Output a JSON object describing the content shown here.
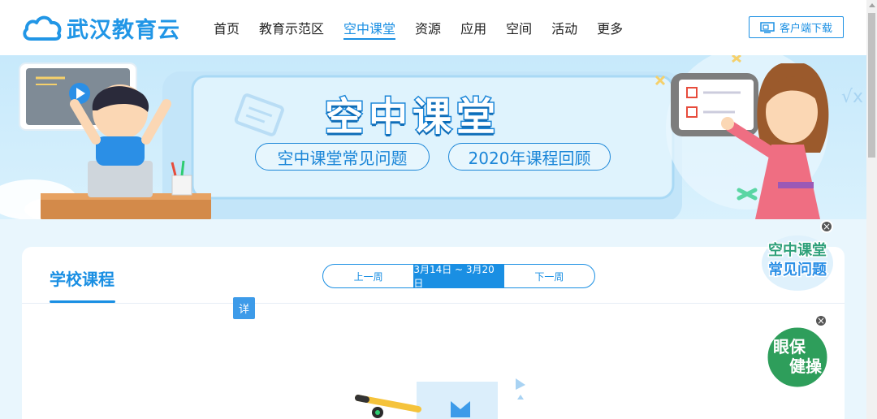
{
  "header": {
    "logo_text": "武汉教育云",
    "nav": [
      {
        "label": "首页"
      },
      {
        "label": "教育示范区"
      },
      {
        "label": "空中课堂",
        "active": true
      },
      {
        "label": "资源"
      },
      {
        "label": "应用"
      },
      {
        "label": "空间"
      },
      {
        "label": "活动"
      },
      {
        "label": "更多"
      }
    ],
    "download_label": "客户端下载"
  },
  "banner": {
    "title": "空中课堂",
    "pills": [
      "空中课堂常见问题",
      "2020年课程回顾"
    ]
  },
  "card": {
    "title": "学校课程",
    "week_prev": "上一周",
    "week_current": "3月14日 ~ 3月20日",
    "week_next": "下一周",
    "detail_tag": "详"
  },
  "floats": {
    "faq_line1": "空中课堂",
    "faq_line2": "常见问题",
    "eye_line1": "眼保",
    "eye_line2": "健操",
    "close_glyph": "×"
  },
  "colors": {
    "accent": "#1a8fe3",
    "background": "#e9f6fd",
    "float_green": "#2e9e5b"
  }
}
